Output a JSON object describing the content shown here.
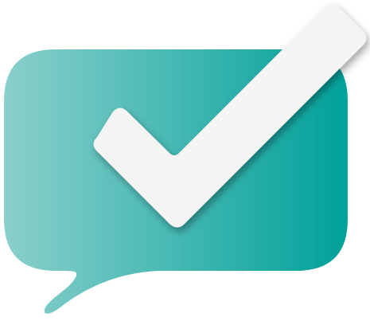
{
  "logo": {
    "name": "speech-bubble-check-logo",
    "bubble_gradient": [
      "#8acfcb",
      "#00a19a"
    ],
    "checkmark_color": "#f4f4f4",
    "checkmark_shadow": "#5f6b6a"
  }
}
